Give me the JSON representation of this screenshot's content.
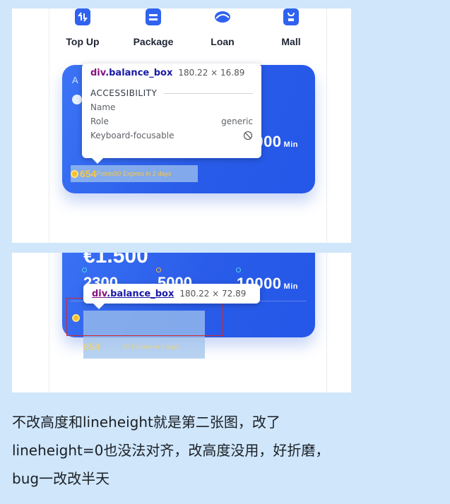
{
  "menu": {
    "items": [
      {
        "label": "Top Up",
        "icon": "top-up-icon"
      },
      {
        "label": "Package",
        "icon": "package-icon"
      },
      {
        "label": "Loan",
        "icon": "loan-icon"
      },
      {
        "label": "Mall",
        "icon": "mall-icon"
      }
    ]
  },
  "card": {
    "amount_top": "€1.500",
    "amount_right": "000",
    "amount_right_unit": "Min",
    "amount_right2": "10000",
    "amount_left_partial": "2300",
    "amount_mid_partial": "5000",
    "points_value": "654",
    "points_label": "Points",
    "points_expire": "50 Expires in 2 days",
    "letter_a": "A"
  },
  "tooltip1": {
    "tag": "div",
    "class_name": ".balance_box",
    "dims": "180.22 × 16.89",
    "section": "ACCESSIBILITY",
    "rows": [
      {
        "label": "Name",
        "value": ""
      },
      {
        "label": "Role",
        "value": "generic"
      },
      {
        "label": "Keyboard-focusable",
        "value": "⃠"
      }
    ]
  },
  "tooltip2": {
    "tag": "div",
    "class_name": ".balance_box",
    "dims": "180.22 × 72.89"
  },
  "caption": {
    "line1": "不改高度和lineheight就是第二张图，改了",
    "line2": "lineheight=0也没法对齐，改高度没用，好折磨，",
    "line3": "bug一改改半天"
  },
  "colors": {
    "background": "#cfe6fb",
    "card_blue": "#2a5ce9",
    "gold": "#f5c84a",
    "highlight": "#a0c3eb",
    "red_box": "#d4282c"
  }
}
